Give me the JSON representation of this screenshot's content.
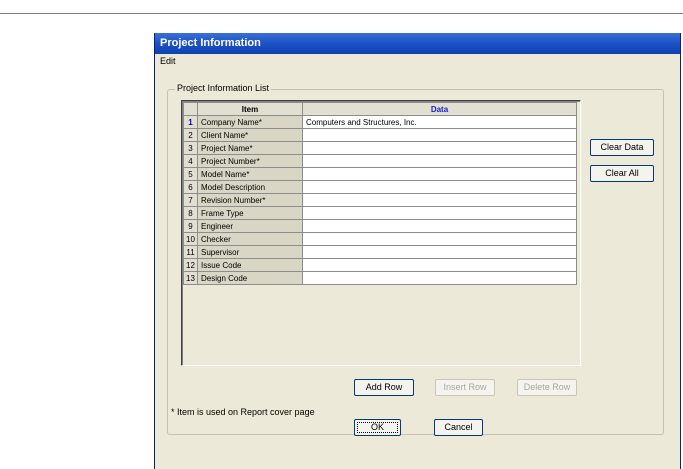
{
  "window": {
    "title": "Project Information"
  },
  "menu": {
    "items": [
      "Edit"
    ]
  },
  "group": {
    "label": "Project Information List"
  },
  "table": {
    "headers": [
      "",
      "Item",
      "Data"
    ],
    "rows": [
      {
        "num": "1",
        "item": "Company Name*",
        "data": "Computers and Structures, Inc."
      },
      {
        "num": "2",
        "item": "Client Name*",
        "data": ""
      },
      {
        "num": "3",
        "item": "Project Name*",
        "data": ""
      },
      {
        "num": "4",
        "item": "Project Number*",
        "data": ""
      },
      {
        "num": "5",
        "item": "Model Name*",
        "data": ""
      },
      {
        "num": "6",
        "item": "Model Description",
        "data": ""
      },
      {
        "num": "7",
        "item": "Revision Number*",
        "data": ""
      },
      {
        "num": "8",
        "item": "Frame Type",
        "data": ""
      },
      {
        "num": "9",
        "item": "Engineer",
        "data": ""
      },
      {
        "num": "10",
        "item": "Checker",
        "data": ""
      },
      {
        "num": "11",
        "item": "Supervisor",
        "data": ""
      },
      {
        "num": "12",
        "item": "Issue Code",
        "data": ""
      },
      {
        "num": "13",
        "item": "Design Code",
        "data": ""
      }
    ]
  },
  "buttons": {
    "clear_data": "Clear Data",
    "clear_all": "Clear All",
    "add_row": "Add Row",
    "insert_row": "Insert Row",
    "delete_row": "Delete Row",
    "ok": "OK",
    "cancel": "Cancel"
  },
  "footnote": "* Item is used on Report cover page",
  "colors": {
    "title_bar": "#1f54c9",
    "window_bg": "#ece9d8",
    "data_header": "#2020d0"
  }
}
